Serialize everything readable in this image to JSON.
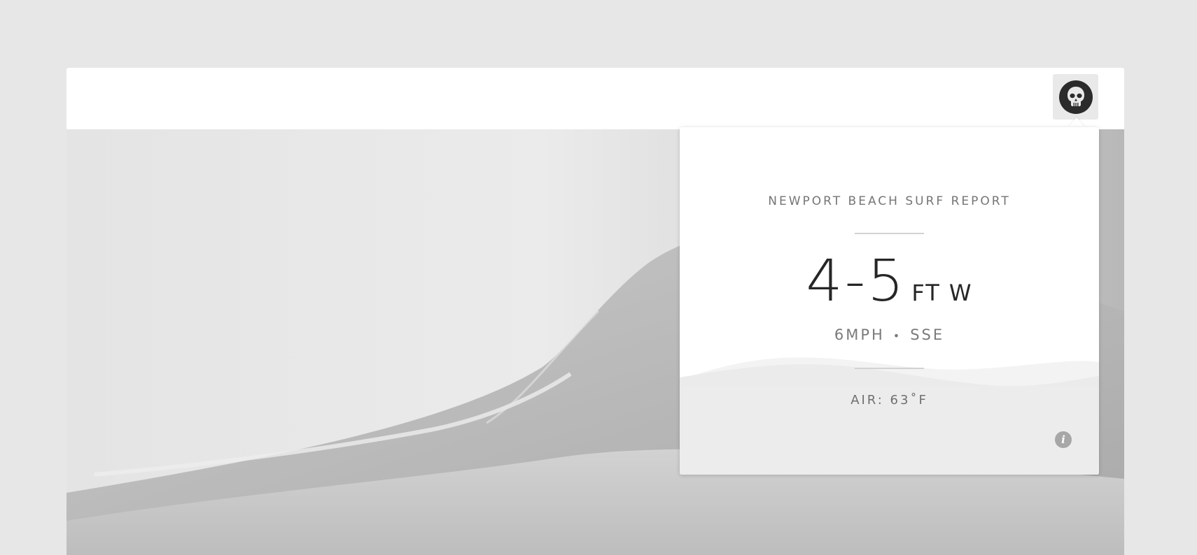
{
  "report": {
    "title": "NEWPORT BEACH SURF REPORT",
    "wave_height": "4-5",
    "wave_unit_direction": "FT W",
    "wind_speed": "6MPH",
    "separator": "•",
    "wind_direction": "SSE",
    "air_temp": "AIR: 63˚F"
  },
  "icons": {
    "avatar": "skull-icon",
    "info": "info-icon"
  },
  "info_glyph": "i",
  "colors": {
    "page_bg": "#e7e7e7",
    "avatar_bg": "#2b2b2b",
    "text_dark": "#262626",
    "text_muted": "#757575"
  }
}
